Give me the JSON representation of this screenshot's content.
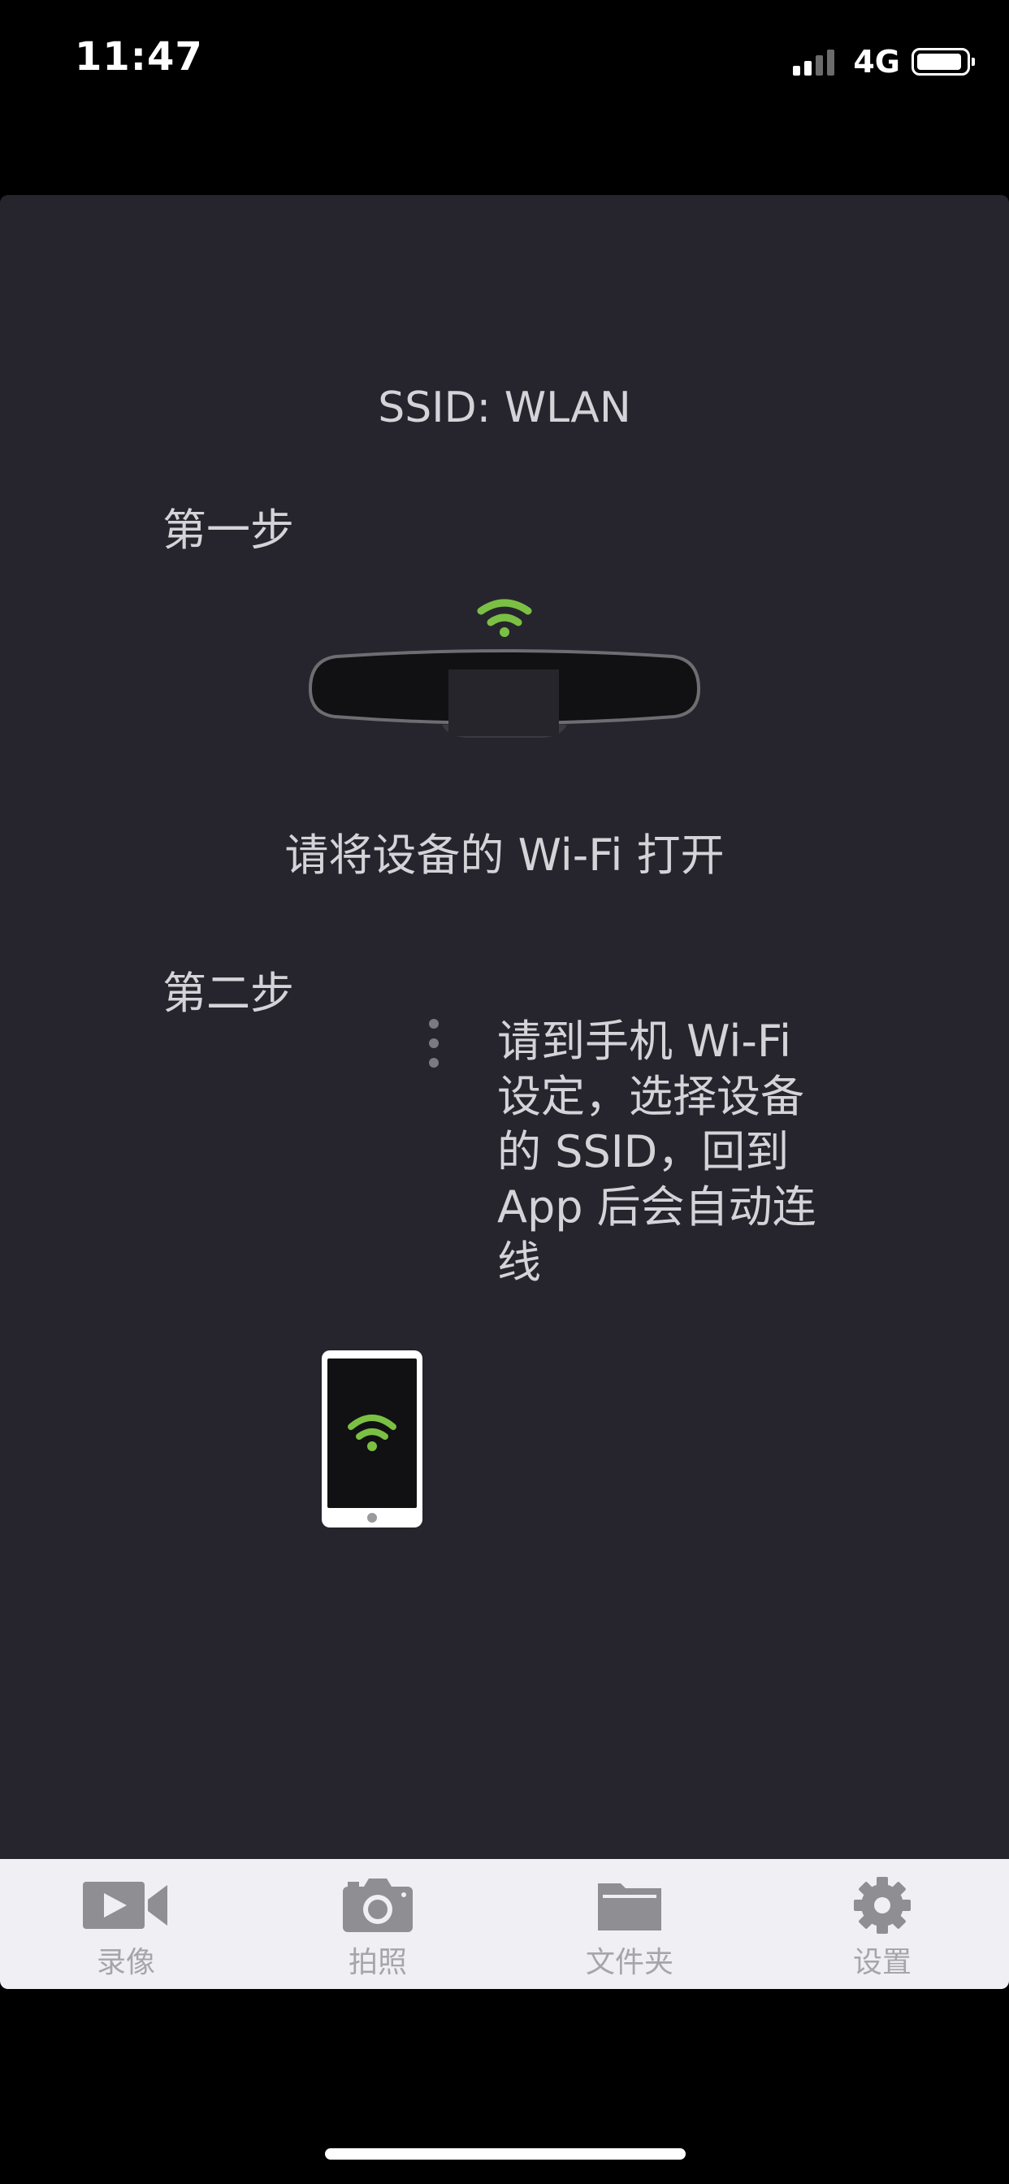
{
  "status_bar": {
    "time": "11:47",
    "network": "4G",
    "signal_icon": "signal-bars-icon",
    "battery_icon": "battery-icon"
  },
  "connect_guide": {
    "ssid": "SSID: WLAN",
    "step1": {
      "heading": "第一步",
      "instruction": "请将设备的 Wi-Fi 打开",
      "device_icon": "rearview-mirror-dashcam-icon",
      "wifi_icon": "wifi-icon"
    },
    "step2": {
      "heading": "第二步",
      "instruction": "请到手机 Wi-Fi\n设定，选择设备\n的 SSID，回到\nApp 后会自动连\n线",
      "device_icon": "phone-icon",
      "wifi_icon": "wifi-icon"
    }
  },
  "tab_bar": {
    "items": [
      {
        "label": "录像",
        "icon": "video-camera-icon"
      },
      {
        "label": "拍照",
        "icon": "camera-icon"
      },
      {
        "label": "文件夹",
        "icon": "folder-icon"
      },
      {
        "label": "设置",
        "icon": "gear-icon"
      }
    ]
  },
  "colors": {
    "panel_background": "#26252e",
    "wifi_green": "#7bc043",
    "tab_bar_background": "#efeff4",
    "tab_icon": "#8e8e93",
    "tab_label": "#a5a5aa"
  }
}
